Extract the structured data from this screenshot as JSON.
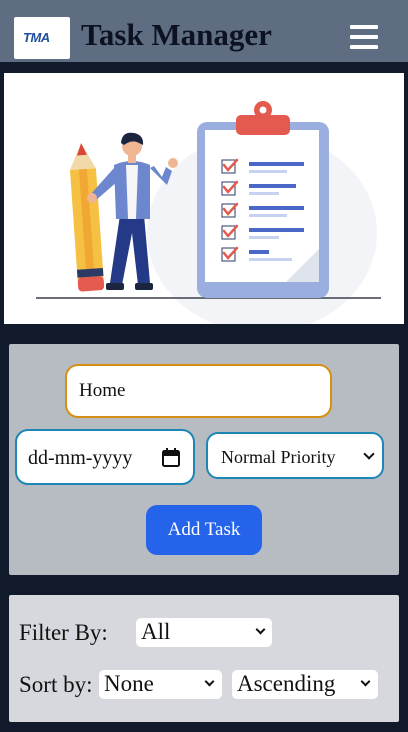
{
  "header": {
    "logo_text": "TMA",
    "title": "Task Manager",
    "menu_icon": "hamburger-menu-icon"
  },
  "hero": {
    "illustration": "person-with-pencil-and-checklist-clipboard"
  },
  "task_form": {
    "task_value": "Home",
    "date_placeholder": "dd-mm-yyyy",
    "priority_selected": "Normal Priority",
    "add_button_label": "Add Task"
  },
  "controls": {
    "filter_label": "Filter By:",
    "filter_selected": "All",
    "sort_label": "Sort by:",
    "sort_selected": "None",
    "order_selected": "Ascending"
  },
  "colors": {
    "header_bg": "#5f6d82",
    "page_bg": "#111a2b",
    "form_card_bg": "#b7bcc2",
    "filter_card_bg": "#d6d8dd",
    "accent_button": "#2563eb",
    "task_input_border": "#d48f14",
    "field_border": "#1e86b5"
  }
}
